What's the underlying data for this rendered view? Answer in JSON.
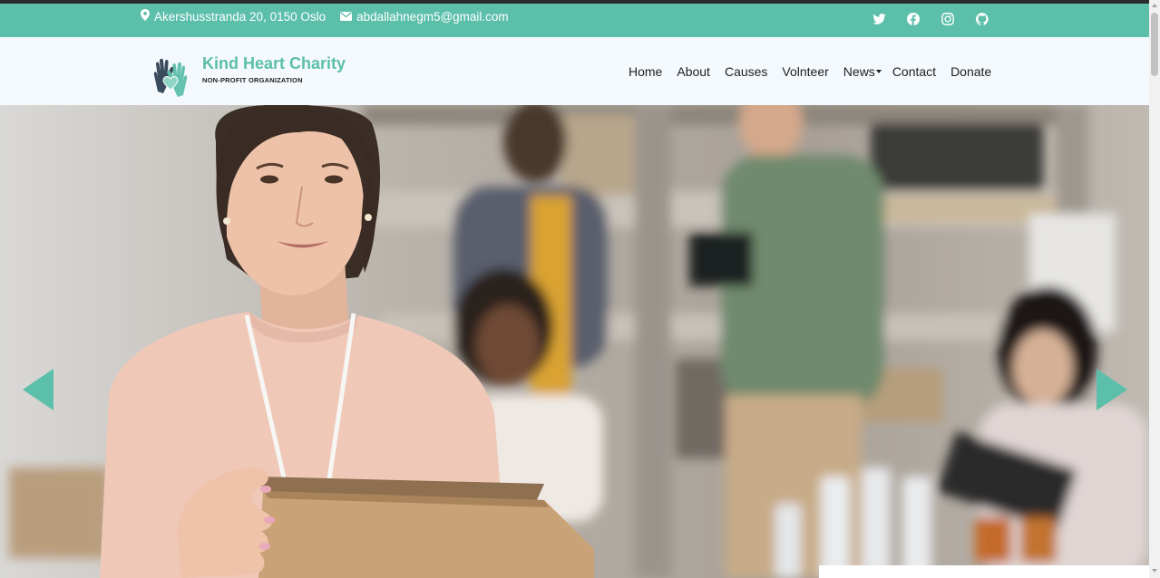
{
  "topbar": {
    "address": "Akershusstranda 20, 0150 Oslo",
    "email": "abdallahnegm5@gmail.com",
    "social_icons": [
      "twitter-icon",
      "facebook-icon",
      "instagram-icon",
      "github-icon"
    ]
  },
  "brand": {
    "name": "Kind Heart Charity",
    "tagline": "NON-PROFIT ORGANIZATION"
  },
  "nav": {
    "items": [
      "Home",
      "About",
      "Causes",
      "Volnteer",
      "News",
      "Contact",
      "Donate"
    ]
  },
  "hero": {
    "image": "woman-holding-cardboard-box-volunteers-background-photo",
    "prev_icon": "chevron-left-icon",
    "next_icon": "chevron-right-icon"
  },
  "colors": {
    "accent": "#5cbfaa",
    "nav_bg": "#f4f9fe",
    "logo_dark": "#3a4b5c"
  }
}
